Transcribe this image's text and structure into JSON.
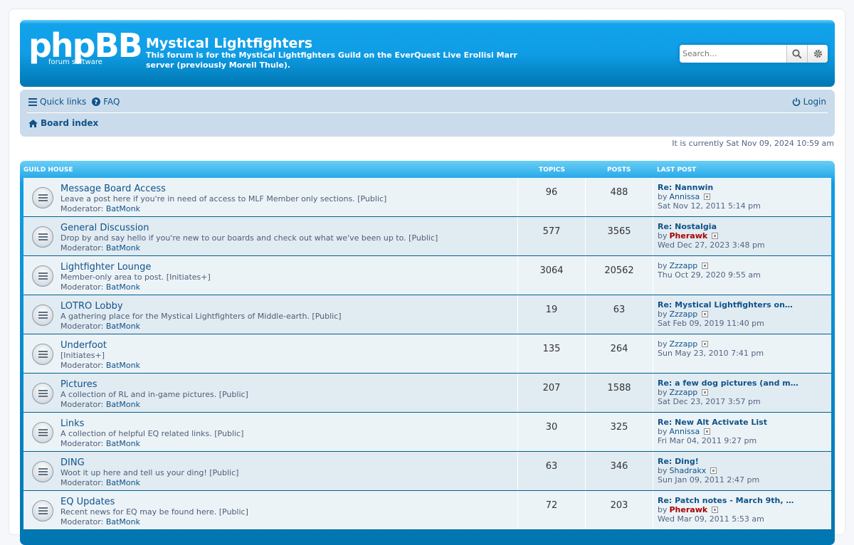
{
  "header": {
    "logo_text": "phpBB",
    "logo_subtext": "forum    software",
    "site_title": "Mystical Lightfighters",
    "site_description": "This forum is for the Mystical Lightfighters Guild on the EverQuest Live Erollisi Marr server (previously Morell Thule).",
    "search_placeholder": "Search…",
    "search_icon": "magnifier-icon",
    "advanced_search_icon": "gear-icon"
  },
  "navbar": {
    "quick_links": "Quick links",
    "faq": "FAQ",
    "login": "Login",
    "board_index": "Board index"
  },
  "current_time": "It is currently Sat Nov 09, 2024 10:59 am",
  "category": {
    "name": "GUILD HOUSE",
    "col_topics": "TOPICS",
    "col_posts": "POSTS",
    "col_last_post": "LAST POST"
  },
  "forums": [
    {
      "title": "Message Board Access",
      "desc": "Leave a post here if you're in need of access to MLF Member only sections. [Public]",
      "mod_label": "Moderator:",
      "moderator": "BatMonk",
      "topics": "96",
      "posts": "488",
      "last_title": "Re: Nannwin",
      "by": "by",
      "last_user": "Annissa",
      "last_user_red": false,
      "last_date": "Sat Nov 12, 2011 5:14 pm"
    },
    {
      "title": "General Discussion",
      "desc": "Drop by and say hello if you're new to our boards and check out what we've been up to. [Public]",
      "mod_label": "Moderator:",
      "moderator": "BatMonk",
      "topics": "577",
      "posts": "3565",
      "last_title": "Re: Nostalgia",
      "by": "by",
      "last_user": "Pherawk",
      "last_user_red": true,
      "last_date": "Wed Dec 27, 2023 3:48 pm"
    },
    {
      "title": "Lightfighter Lounge",
      "desc": "Member-only area to post. [Initiates+]",
      "mod_label": "Moderator:",
      "moderator": "BatMonk",
      "topics": "3064",
      "posts": "20562",
      "last_title": "",
      "by": "by",
      "last_user": "Zzzapp",
      "last_user_red": false,
      "last_date": "Thu Oct 29, 2020 9:55 am"
    },
    {
      "title": "LOTRO Lobby",
      "desc": "A gathering place for the Mystical Lightfighters of Middle-earth. [Public]",
      "mod_label": "Moderator:",
      "moderator": "BatMonk",
      "topics": "19",
      "posts": "63",
      "last_title": "Re: Mystical Lightfighters on…",
      "by": "by",
      "last_user": "Zzzapp",
      "last_user_red": false,
      "last_date": "Sat Feb 09, 2019 11:40 pm"
    },
    {
      "title": "Underfoot",
      "desc": "[Initiates+]",
      "mod_label": "Moderator:",
      "moderator": "BatMonk",
      "topics": "135",
      "posts": "264",
      "last_title": "",
      "by": "by",
      "last_user": "Zzzapp",
      "last_user_red": false,
      "last_date": "Sun May 23, 2010 7:41 pm"
    },
    {
      "title": "Pictures",
      "desc": "A collection of RL and in-game pictures. [Public]",
      "mod_label": "Moderator:",
      "moderator": "BatMonk",
      "topics": "207",
      "posts": "1588",
      "last_title": "Re: a few dog pictures (and m…",
      "by": "by",
      "last_user": "Zzzapp",
      "last_user_red": false,
      "last_date": "Sat Dec 23, 2017 3:57 pm"
    },
    {
      "title": "Links",
      "desc": "A collection of helpful EQ related links. [Public]",
      "mod_label": "Moderator:",
      "moderator": "BatMonk",
      "topics": "30",
      "posts": "325",
      "last_title": "Re: New Alt Activate List",
      "by": "by",
      "last_user": "Annissa",
      "last_user_red": false,
      "last_date": "Fri Mar 04, 2011 9:27 pm"
    },
    {
      "title": "DING",
      "desc": "Woot it up here and tell us your ding! [Public]",
      "mod_label": "Moderator:",
      "moderator": "BatMonk",
      "topics": "63",
      "posts": "346",
      "last_title": "Re: Ding!",
      "by": "by",
      "last_user": "Shadrakx",
      "last_user_red": false,
      "last_date": "Sun Jan 09, 2011 2:47 pm"
    },
    {
      "title": "EQ Updates",
      "desc": "Recent news for EQ may be found here. [Public]",
      "mod_label": "Moderator:",
      "moderator": "BatMonk",
      "topics": "72",
      "posts": "203",
      "last_title": "Re: Patch notes - March 9th, …",
      "by": "by",
      "last_user": "Pherawk",
      "last_user_red": true,
      "last_date": "Wed Mar 09, 2011 5:53 am"
    }
  ]
}
